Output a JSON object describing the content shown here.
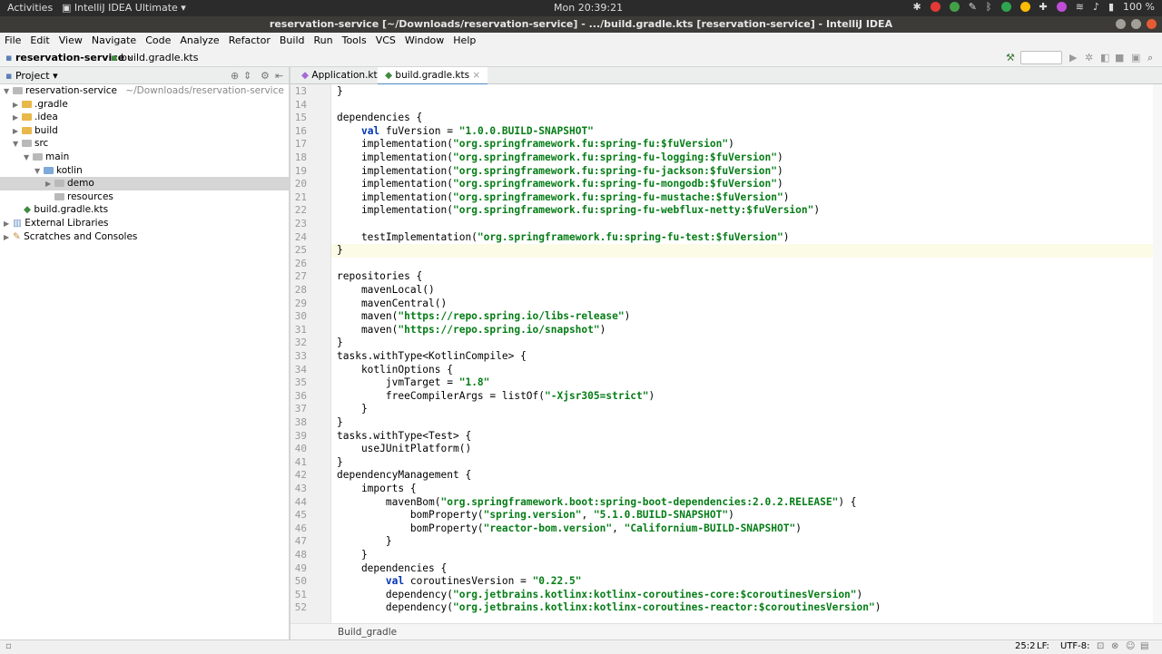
{
  "os": {
    "activities": "Activities",
    "app_name": "IntelliJ IDEA Ultimate",
    "clock": "Mon 20:39:21",
    "battery": "100 %"
  },
  "window_title": "reservation-service [~/Downloads/reservation-service] - .../build.gradle.kts [reservation-service] - IntelliJ IDEA",
  "menu": [
    "File",
    "Edit",
    "View",
    "Navigate",
    "Code",
    "Analyze",
    "Refactor",
    "Build",
    "Run",
    "Tools",
    "VCS",
    "Window",
    "Help"
  ],
  "breadcrumb": {
    "project": "reservation-service",
    "file": "build.gradle.kts"
  },
  "project_panel": {
    "title": "Project"
  },
  "tree": [
    {
      "label": "reservation-service",
      "path": "~/Downloads/reservation-service",
      "indent": 0,
      "type": "module"
    },
    {
      "label": ".gradle",
      "indent": 1,
      "type": "folder"
    },
    {
      "label": ".idea",
      "indent": 1,
      "type": "folder"
    },
    {
      "label": "build",
      "indent": 1,
      "type": "folder"
    },
    {
      "label": "src",
      "indent": 1,
      "type": "folder-open"
    },
    {
      "label": "main",
      "indent": 2,
      "type": "folder-open"
    },
    {
      "label": "kotlin",
      "indent": 3,
      "type": "folder-blue"
    },
    {
      "label": "demo",
      "indent": 4,
      "type": "package",
      "selected": true
    },
    {
      "label": "resources",
      "indent": 3,
      "type": "folder-gray"
    },
    {
      "label": "build.gradle.kts",
      "indent": 1,
      "type": "file"
    },
    {
      "label": "External Libraries",
      "indent": 0,
      "type": "lib"
    },
    {
      "label": "Scratches and Consoles",
      "indent": 0,
      "type": "scratch"
    }
  ],
  "tabs": [
    {
      "label": "Application.kt",
      "active": false
    },
    {
      "label": "build.gradle.kts",
      "active": true
    }
  ],
  "code_lines": [
    {
      "n": "13",
      "t": "}"
    },
    {
      "n": "14",
      "t": ""
    },
    {
      "n": "15",
      "t": "dependencies {"
    },
    {
      "n": "16",
      "t": "    val fuVersion = \"1.0.0.BUILD-SNAPSHOT\""
    },
    {
      "n": "17",
      "t": "    implementation(\"org.springframework.fu:spring-fu:$fuVersion\")"
    },
    {
      "n": "18",
      "t": "    implementation(\"org.springframework.fu:spring-fu-logging:$fuVersion\")"
    },
    {
      "n": "19",
      "t": "    implementation(\"org.springframework.fu:spring-fu-jackson:$fuVersion\")"
    },
    {
      "n": "20",
      "t": "    implementation(\"org.springframework.fu:spring-fu-mongodb:$fuVersion\")"
    },
    {
      "n": "21",
      "t": "    implementation(\"org.springframework.fu:spring-fu-mustache:$fuVersion\")"
    },
    {
      "n": "22",
      "t": "    implementation(\"org.springframework.fu:spring-fu-webflux-netty:$fuVersion\")"
    },
    {
      "n": "23",
      "t": ""
    },
    {
      "n": "24",
      "t": "    testImplementation(\"org.springframework.fu:spring-fu-test:$fuVersion\")"
    },
    {
      "n": "25",
      "t": "}",
      "current": true
    },
    {
      "n": "26",
      "t": ""
    },
    {
      "n": "27",
      "t": "repositories {"
    },
    {
      "n": "28",
      "t": "    mavenLocal()"
    },
    {
      "n": "29",
      "t": "    mavenCentral()"
    },
    {
      "n": "30",
      "t": "    maven(\"https://repo.spring.io/libs-release\")"
    },
    {
      "n": "31",
      "t": "    maven(\"https://repo.spring.io/snapshot\")"
    },
    {
      "n": "32",
      "t": "}"
    },
    {
      "n": "33",
      "t": "tasks.withType<KotlinCompile> {"
    },
    {
      "n": "34",
      "t": "    kotlinOptions {"
    },
    {
      "n": "35",
      "t": "        jvmTarget = \"1.8\""
    },
    {
      "n": "36",
      "t": "        freeCompilerArgs = listOf(\"-Xjsr305=strict\")"
    },
    {
      "n": "37",
      "t": "    }"
    },
    {
      "n": "38",
      "t": "}"
    },
    {
      "n": "39",
      "t": "tasks.withType<Test> {"
    },
    {
      "n": "40",
      "t": "    useJUnitPlatform()"
    },
    {
      "n": "41",
      "t": "}"
    },
    {
      "n": "42",
      "t": "dependencyManagement {"
    },
    {
      "n": "43",
      "t": "    imports {"
    },
    {
      "n": "44",
      "t": "        mavenBom(\"org.springframework.boot:spring-boot-dependencies:2.0.2.RELEASE\") {"
    },
    {
      "n": "45",
      "t": "            bomProperty(\"spring.version\", \"5.1.0.BUILD-SNAPSHOT\")"
    },
    {
      "n": "46",
      "t": "            bomProperty(\"reactor-bom.version\", \"Californium-BUILD-SNAPSHOT\")"
    },
    {
      "n": "47",
      "t": "        }"
    },
    {
      "n": "48",
      "t": "    }"
    },
    {
      "n": "49",
      "t": "    dependencies {"
    },
    {
      "n": "50",
      "t": "        val coroutinesVersion = \"0.22.5\""
    },
    {
      "n": "51",
      "t": "        dependency(\"org.jetbrains.kotlinx:kotlinx-coroutines-core:$coroutinesVersion\")"
    },
    {
      "n": "52",
      "t": "        dependency(\"org.jetbrains.kotlinx:kotlinx-coroutines-reactor:$coroutinesVersion\")"
    }
  ],
  "editor_breadcrumb": "Build_gradle",
  "status": {
    "position": "25:2",
    "line_sep": "LF:",
    "encoding": "UTF-8:"
  }
}
